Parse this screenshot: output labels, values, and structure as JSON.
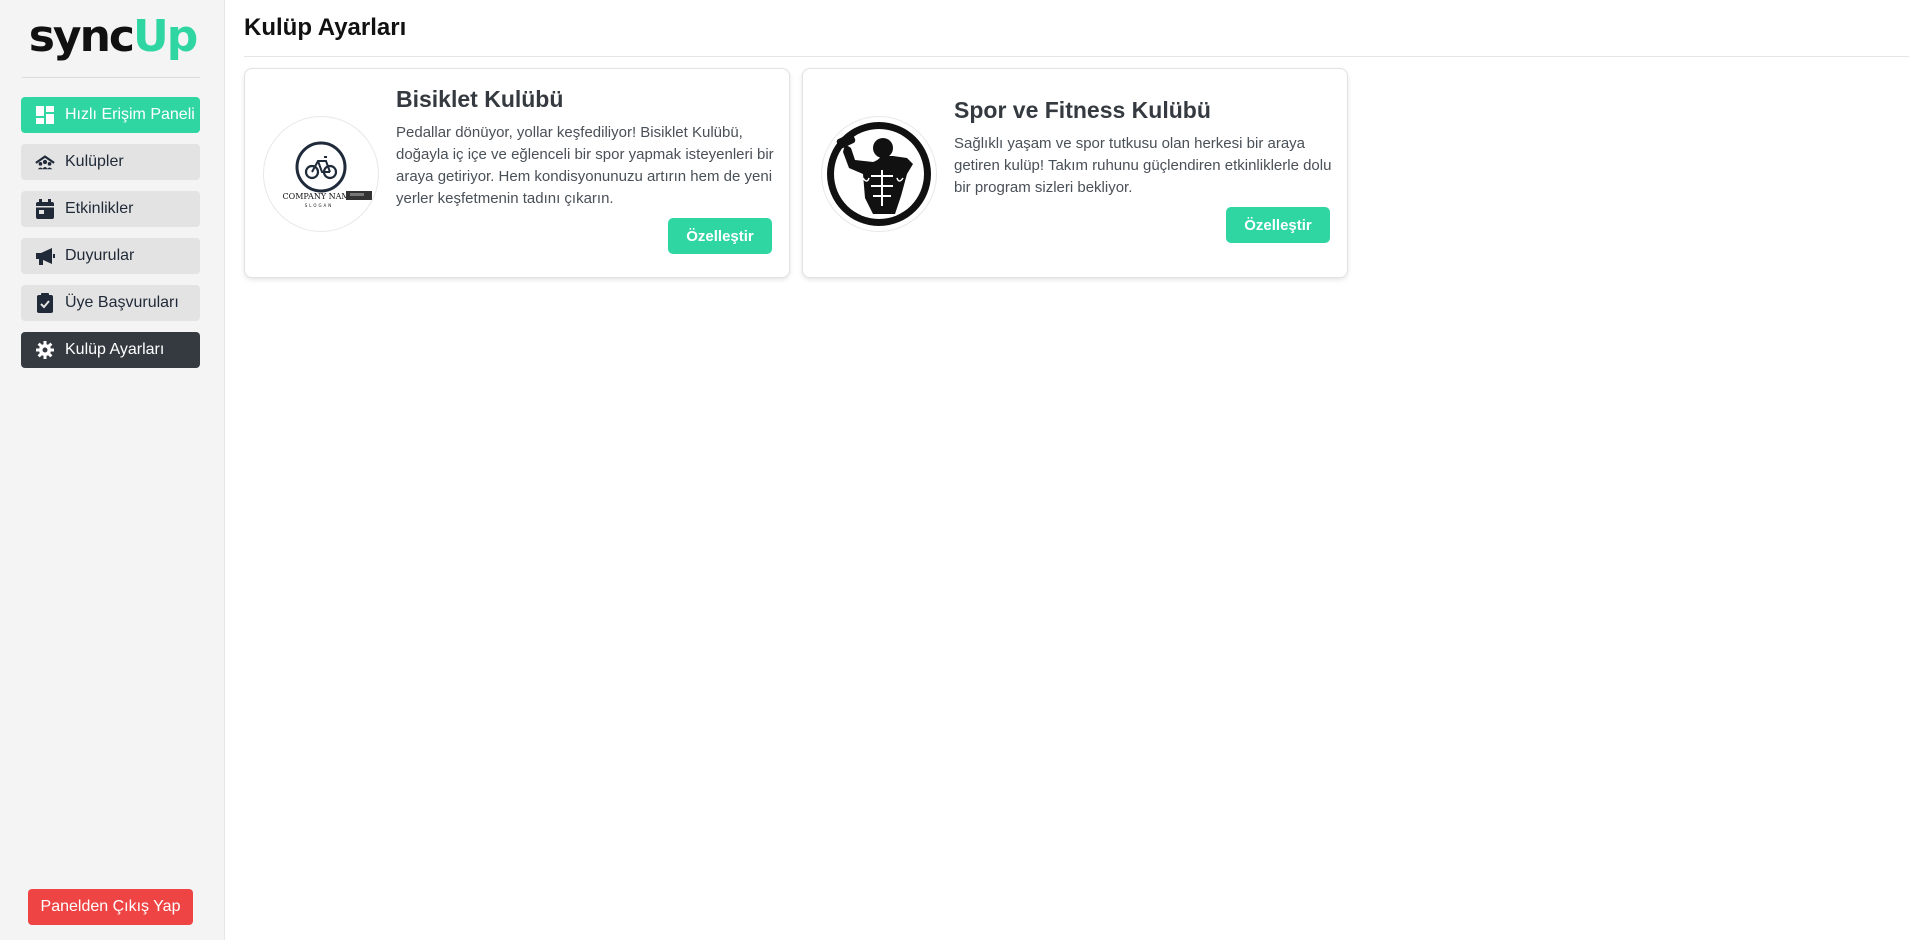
{
  "app": {
    "logo_sync": "sync",
    "logo_up": "Up"
  },
  "sidebar": {
    "items": [
      {
        "label": "Hızlı Erişim Paneli",
        "icon": "dashboard-icon"
      },
      {
        "label": "Kulüpler",
        "icon": "club-icon"
      },
      {
        "label": "Etkinlikler",
        "icon": "calendar-icon"
      },
      {
        "label": "Duyurular",
        "icon": "megaphone-icon"
      },
      {
        "label": "Üye Başvuruları",
        "icon": "clipboard-check-icon"
      },
      {
        "label": "Kulüp Ayarları",
        "icon": "gear-icon"
      }
    ],
    "logout_label": "Panelden Çıkış Yap"
  },
  "main": {
    "title": "Kulüp Ayarları",
    "cards": [
      {
        "title": "Bisiklet Kulübü",
        "description": "Pedallar dönüyor, yollar keşfediliyor! Bisiklet Kulübü, doğayla iç içe ve eğlenceli bir spor yapmak isteyenleri bir araya getiriyor. Hem kondisyonunuzu artırın hem de yeni yerler keşfetmenin tadını çıkarın.",
        "button": "Özelleştir",
        "logo_text": "COMPANY NAME",
        "logo_slogan": "SLOGAN"
      },
      {
        "title": "Spor ve Fitness Kulübü",
        "description": "Sağlıklı yaşam ve spor tutkusu olan herkesi bir araya getiren kulüp! Takım ruhunu güçlendiren etkinliklerle dolu bir program sizleri bekliyor.",
        "button": "Özelleştir"
      }
    ]
  },
  "colors": {
    "accent": "#2fd6a2",
    "active": "#343a40",
    "danger": "#ef4444",
    "sidebar_bg": "#f4f4f4"
  }
}
